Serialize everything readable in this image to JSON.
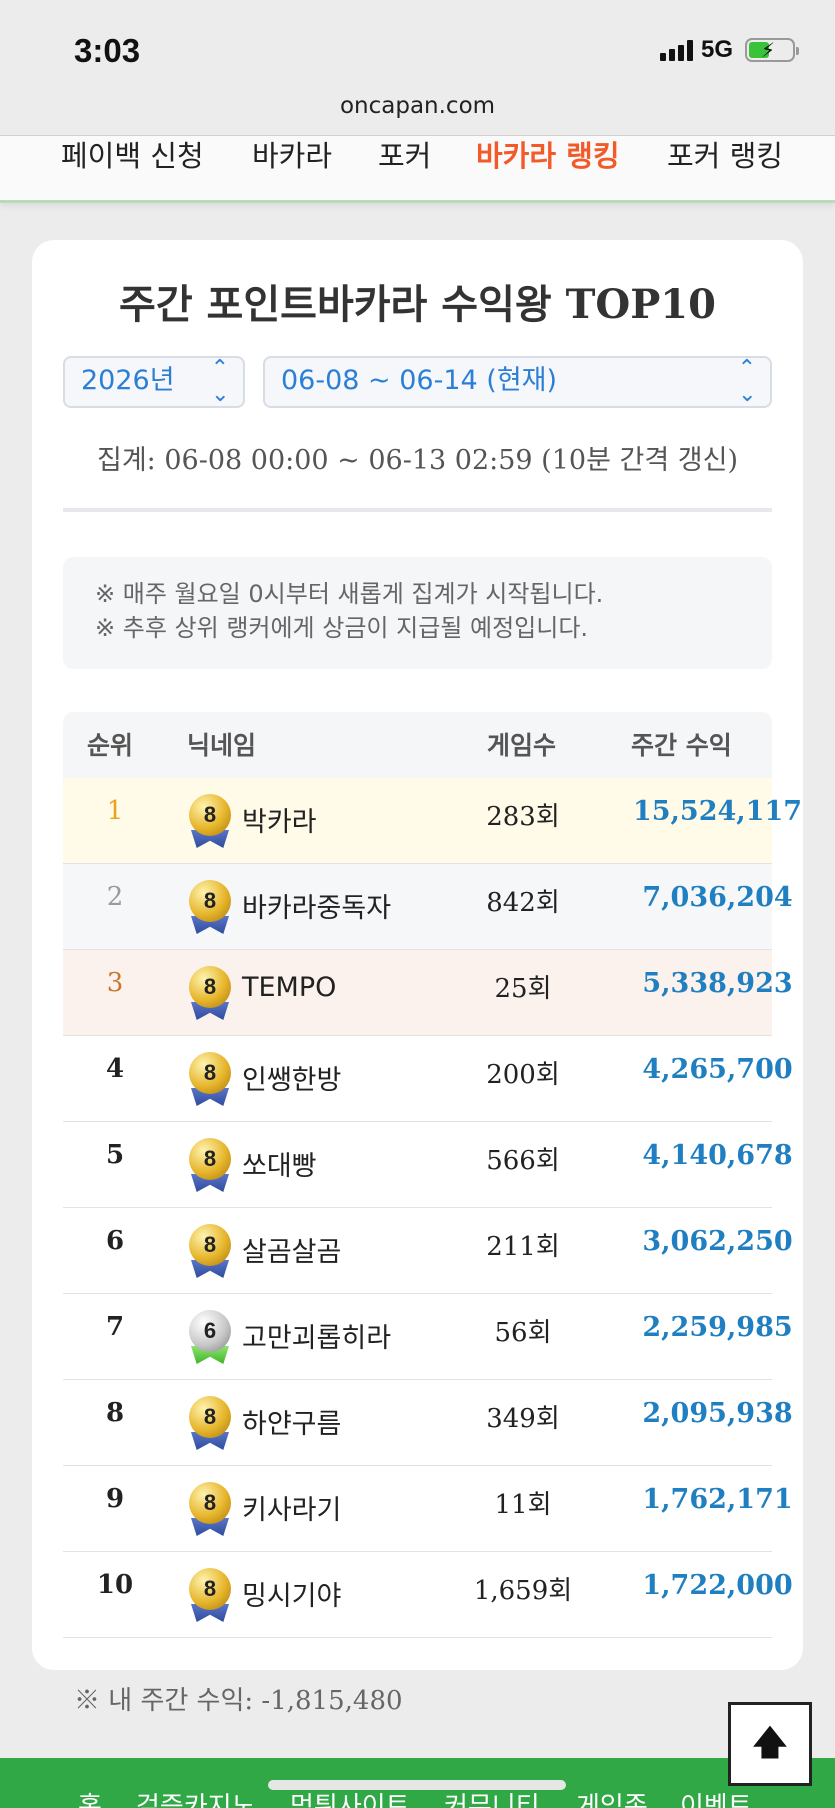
{
  "status": {
    "time": "3:03",
    "network": "5G"
  },
  "browser": {
    "url": "oncapan.com"
  },
  "topnav": [
    "페이백 신청",
    "바카라",
    "포커",
    "바카라 랭킹",
    "포커 랭킹"
  ],
  "ranking": {
    "title": "주간 포인트바카라 수익왕 TOP10",
    "year_select": "2026년",
    "week_select": "06-08 ~ 06-14 (현재)",
    "range_note": "집계: 06-08 00:00 ~ 06-13 02:59 (10분 간격 갱신)",
    "notice": [
      "※ 매주 월요일 0시부터 새롭게 집계가 시작됩니다.",
      "※ 추후 상위 랭커에게 상금이 지급될 예정입니다."
    ],
    "headers": {
      "rank": "순위",
      "nick": "닉네임",
      "games": "게임수",
      "profit": "주간 수익"
    },
    "rows": [
      {
        "rank": "1",
        "level": "8",
        "nick": "박카라",
        "games": "283회",
        "profit": "15,524,117"
      },
      {
        "rank": "2",
        "level": "8",
        "nick": "바카라중독자",
        "games": "842회",
        "profit": "7,036,204"
      },
      {
        "rank": "3",
        "level": "8",
        "nick": "TEMPO",
        "games": "25회",
        "profit": "5,338,923"
      },
      {
        "rank": "4",
        "level": "8",
        "nick": "인쌩한방",
        "games": "200회",
        "profit": "4,265,700"
      },
      {
        "rank": "5",
        "level": "8",
        "nick": "쏘대빵",
        "games": "566회",
        "profit": "4,140,678"
      },
      {
        "rank": "6",
        "level": "8",
        "nick": "살곰살곰",
        "games": "211회",
        "profit": "3,062,250"
      },
      {
        "rank": "7",
        "level": "6",
        "nick": "고만괴롭히라",
        "games": "56회",
        "profit": "2,259,985"
      },
      {
        "rank": "8",
        "level": "8",
        "nick": "하얀구름",
        "games": "349회",
        "profit": "2,095,938"
      },
      {
        "rank": "9",
        "level": "8",
        "nick": "키사라기",
        "games": "11회",
        "profit": "1,762,171"
      },
      {
        "rank": "10",
        "level": "8",
        "nick": "밍시기야",
        "games": "1,659회",
        "profit": "1,722,000"
      }
    ],
    "my_profit": "※ 내 주간 수익: -1,815,480"
  },
  "bottomnav": [
    "홈",
    "검증카지노",
    "먹튀사이트",
    "커뮤니티",
    "게임존",
    "이벤트"
  ],
  "colors": {
    "active_nav": "#f25a2a",
    "profit": "#1f7fc0",
    "bottom_bar": "#2fa845"
  },
  "icons": {
    "scroll_top": "arrow-up-icon"
  }
}
